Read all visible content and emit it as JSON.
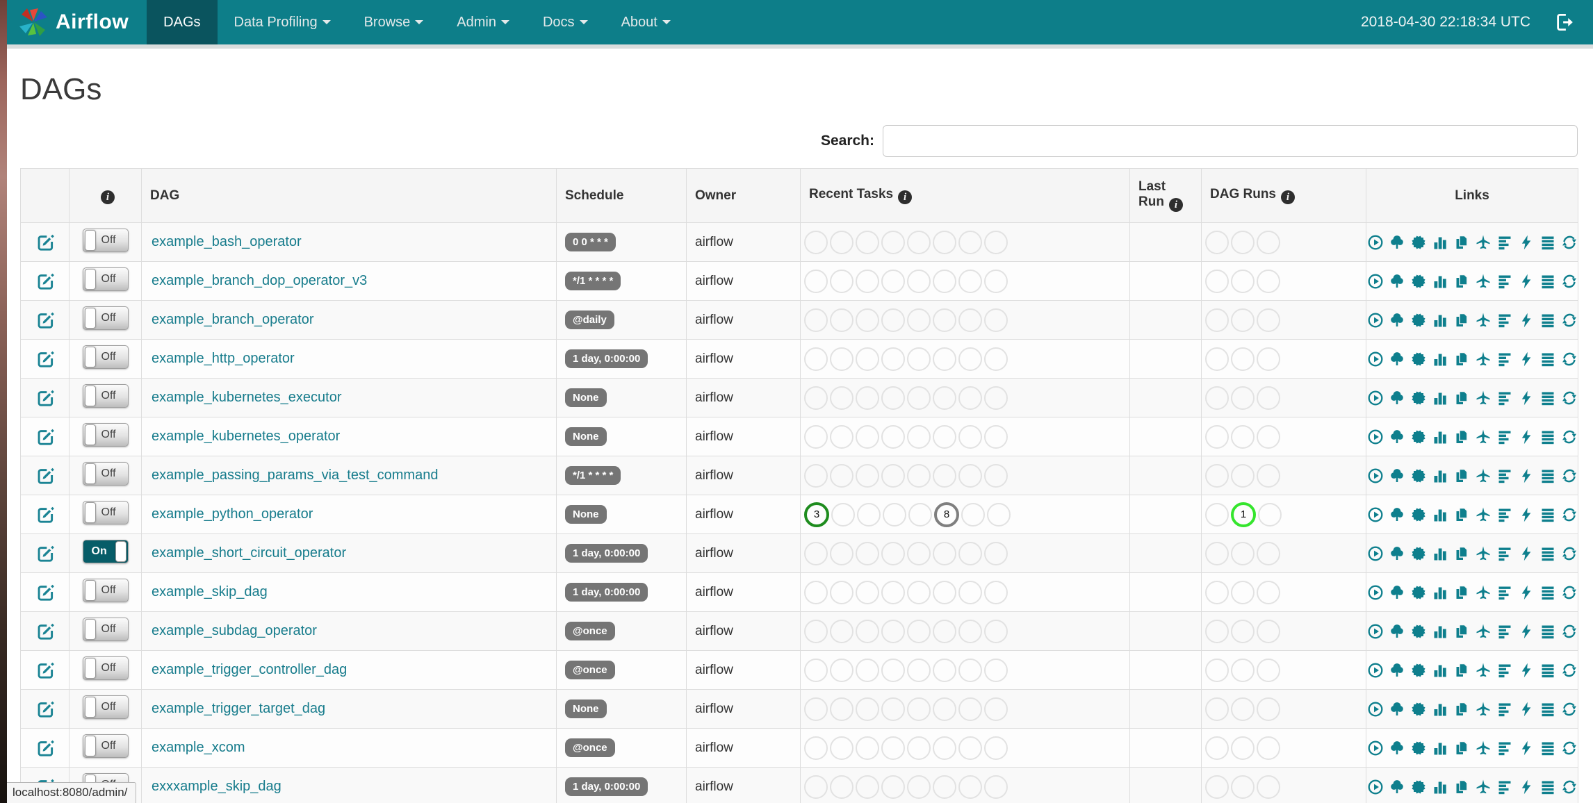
{
  "colors": {
    "navbar": "#0d7e89",
    "navbar_active": "#0a545e",
    "link": "#177c8c",
    "icon_teal": "#0e7f8d",
    "badge_gray": "#757575",
    "state_success": "#1e8c1e",
    "state_running": "#35e52d",
    "state_queued": "#7f7f7f",
    "circle_empty": "#e2e2e2"
  },
  "navbar": {
    "brand": "Airflow",
    "items": [
      {
        "label": "DAGs",
        "active": true,
        "caret": false
      },
      {
        "label": "Data Profiling",
        "active": false,
        "caret": true
      },
      {
        "label": "Browse",
        "active": false,
        "caret": true
      },
      {
        "label": "Admin",
        "active": false,
        "caret": true
      },
      {
        "label": "Docs",
        "active": false,
        "caret": true
      },
      {
        "label": "About",
        "active": false,
        "caret": true
      }
    ],
    "clock": "2018-04-30 22:18:34 UTC"
  },
  "page": {
    "title": "DAGs",
    "search_label": "Search:",
    "search_value": "",
    "status_bar": "localhost:8080/admin/"
  },
  "icons": {
    "info_glyph": "i"
  },
  "table": {
    "headers": [
      {
        "key": "edit",
        "label": "",
        "info": false
      },
      {
        "key": "info",
        "label": "",
        "info": true
      },
      {
        "key": "dag",
        "label": "DAG",
        "info": false
      },
      {
        "key": "sched",
        "label": "Schedule",
        "info": false
      },
      {
        "key": "owner",
        "label": "Owner",
        "info": false
      },
      {
        "key": "recent",
        "label": "Recent Tasks",
        "info": true
      },
      {
        "key": "lastrun",
        "label": "Last Run",
        "info": true
      },
      {
        "key": "runs",
        "label": "DAG Runs",
        "info": true
      },
      {
        "key": "links",
        "label": "Links",
        "info": false
      }
    ],
    "recent_slots": 8,
    "run_slots": 3
  },
  "links": [
    "trigger-dag",
    "tree-view",
    "graph-view",
    "task-duration",
    "task-tries",
    "landing-times",
    "gantt-view",
    "code-view",
    "logs",
    "refresh"
  ],
  "dags": [
    {
      "name": "example_bash_operator",
      "toggle_label": "Off",
      "enabled": false,
      "schedule": "0 0 * * *",
      "owner": "airflow",
      "last_run": "",
      "recent_tasks": [],
      "dag_runs": []
    },
    {
      "name": "example_branch_dop_operator_v3",
      "toggle_label": "Off",
      "enabled": false,
      "schedule": "*/1 * * * *",
      "owner": "airflow",
      "last_run": "",
      "recent_tasks": [],
      "dag_runs": []
    },
    {
      "name": "example_branch_operator",
      "toggle_label": "Off",
      "enabled": false,
      "schedule": "@daily",
      "owner": "airflow",
      "last_run": "",
      "recent_tasks": [],
      "dag_runs": []
    },
    {
      "name": "example_http_operator",
      "toggle_label": "Off",
      "enabled": false,
      "schedule": "1 day, 0:00:00",
      "owner": "airflow",
      "last_run": "",
      "recent_tasks": [],
      "dag_runs": []
    },
    {
      "name": "example_kubernetes_executor",
      "toggle_label": "Off",
      "enabled": false,
      "schedule": "None",
      "owner": "airflow",
      "last_run": "",
      "recent_tasks": [],
      "dag_runs": []
    },
    {
      "name": "example_kubernetes_operator",
      "toggle_label": "Off",
      "enabled": false,
      "schedule": "None",
      "owner": "airflow",
      "last_run": "",
      "recent_tasks": [],
      "dag_runs": []
    },
    {
      "name": "example_passing_params_via_test_command",
      "toggle_label": "Off",
      "enabled": false,
      "schedule": "*/1 * * * *",
      "owner": "airflow",
      "last_run": "",
      "recent_tasks": [],
      "dag_runs": []
    },
    {
      "name": "example_python_operator",
      "toggle_label": "Off",
      "enabled": false,
      "schedule": "None",
      "owner": "airflow",
      "last_run": "",
      "recent_tasks": [
        {
          "slot": 1,
          "count": 3,
          "state": "success"
        },
        {
          "slot": 6,
          "count": 8,
          "state": "queued"
        }
      ],
      "dag_runs": [
        {
          "slot": 2,
          "count": 1,
          "state": "running"
        }
      ]
    },
    {
      "name": "example_short_circuit_operator",
      "toggle_label": "On",
      "enabled": true,
      "schedule": "1 day, 0:00:00",
      "owner": "airflow",
      "last_run": "",
      "recent_tasks": [],
      "dag_runs": []
    },
    {
      "name": "example_skip_dag",
      "toggle_label": "Off",
      "enabled": false,
      "schedule": "1 day, 0:00:00",
      "owner": "airflow",
      "last_run": "",
      "recent_tasks": [],
      "dag_runs": []
    },
    {
      "name": "example_subdag_operator",
      "toggle_label": "Off",
      "enabled": false,
      "schedule": "@once",
      "owner": "airflow",
      "last_run": "",
      "recent_tasks": [],
      "dag_runs": []
    },
    {
      "name": "example_trigger_controller_dag",
      "toggle_label": "Off",
      "enabled": false,
      "schedule": "@once",
      "owner": "airflow",
      "last_run": "",
      "recent_tasks": [],
      "dag_runs": []
    },
    {
      "name": "example_trigger_target_dag",
      "toggle_label": "Off",
      "enabled": false,
      "schedule": "None",
      "owner": "airflow",
      "last_run": "",
      "recent_tasks": [],
      "dag_runs": []
    },
    {
      "name": "example_xcom",
      "toggle_label": "Off",
      "enabled": false,
      "schedule": "@once",
      "owner": "airflow",
      "last_run": "",
      "recent_tasks": [],
      "dag_runs": []
    },
    {
      "name": "exxxample_skip_dag",
      "toggle_label": "Off",
      "enabled": false,
      "schedule": "1 day, 0:00:00",
      "owner": "airflow",
      "last_run": "",
      "recent_tasks": [],
      "dag_runs": []
    }
  ]
}
